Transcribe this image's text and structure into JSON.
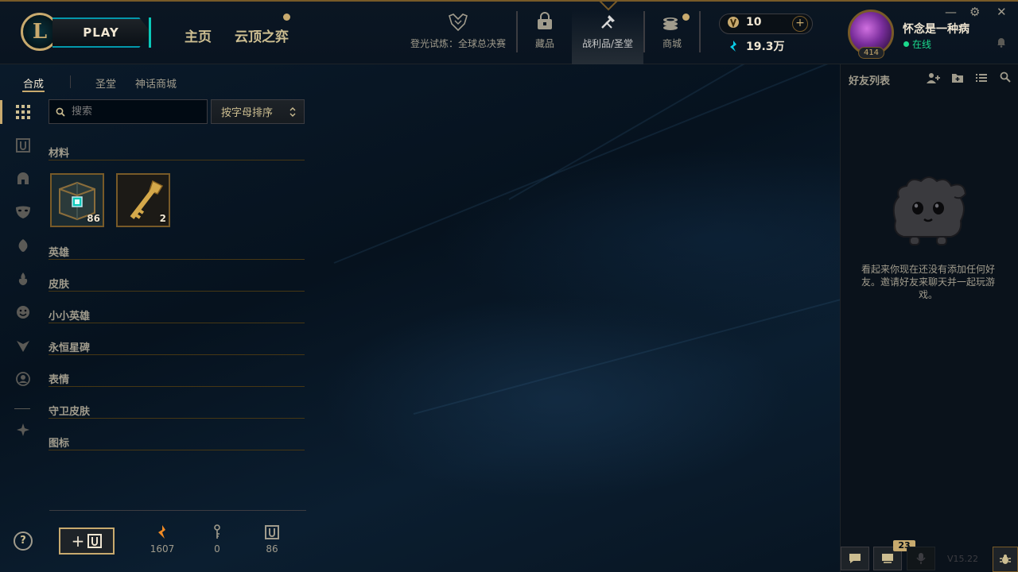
{
  "top_nav": {
    "play_label": "PLAY",
    "home_label": "主页",
    "tft_label": "云顶之弈",
    "items": [
      {
        "label": "登光试炼：全球总决赛",
        "icon": "worlds-icon"
      },
      {
        "label": "藏品",
        "icon": "collection-icon"
      },
      {
        "label": "战利品/圣堂",
        "icon": "loot-icon",
        "active": true
      },
      {
        "label": "商城",
        "icon": "store-icon"
      }
    ]
  },
  "currency": {
    "rp": "10",
    "blue_essence": "19.3万",
    "add_label": "+"
  },
  "profile": {
    "name": "怀念是一种病",
    "status": "在线",
    "level": "414"
  },
  "sub_tabs": {
    "craft": "合成",
    "sanctum": "圣堂",
    "mythic_shop": "神话商城"
  },
  "search": {
    "placeholder": "搜索"
  },
  "sort": {
    "value": "按字母排序"
  },
  "sections": [
    "材料",
    "英雄",
    "皮肤",
    "小小英雄",
    "永恒星碑",
    "表情",
    "守卫皮肤",
    "图标"
  ],
  "materials": [
    {
      "name": "chest",
      "count": "86"
    },
    {
      "name": "key",
      "count": "2"
    }
  ],
  "footer": {
    "help": "?",
    "craft_button_plus": "+",
    "counters": [
      {
        "icon": "orange-essence-icon",
        "value": "1607"
      },
      {
        "icon": "key-fragment-icon",
        "value": "0"
      },
      {
        "icon": "chest-icon",
        "value": "86"
      }
    ]
  },
  "friends": {
    "title": "好友列表",
    "empty_message": "看起来你现在还没有添加任何好友。邀请好友来聊天并一起玩游戏。",
    "chat_badge": "23",
    "version": "V15.22"
  },
  "colors": {
    "gold": "#c8aa6e",
    "teal": "#0ac8b9",
    "online_green": "#1bd98d",
    "background": "#010a13"
  }
}
